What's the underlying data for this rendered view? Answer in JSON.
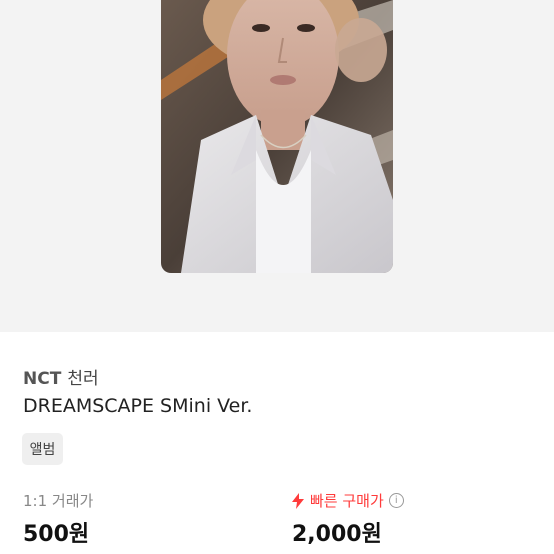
{
  "product": {
    "artist": "NCT",
    "member": "천러",
    "title": "DREAMSCAPE SMini Ver.",
    "category_tag": "앨범"
  },
  "pricing": {
    "one_to_one_label": "1:1 거래가",
    "one_to_one_price": "500원",
    "fast_buy_label": "빠른 구매가",
    "fast_buy_price": "2,000원",
    "fast_buy_icon": "lightning-icon",
    "info_icon": "info-icon",
    "accent_color": "#ff3b3b"
  }
}
